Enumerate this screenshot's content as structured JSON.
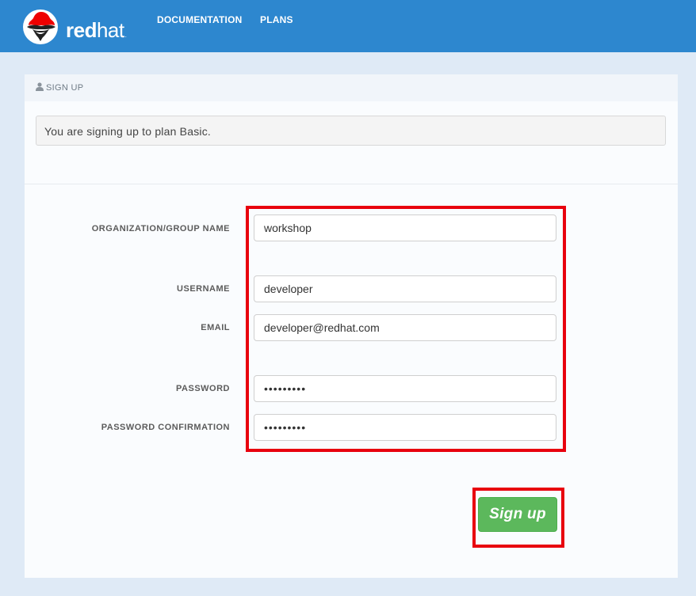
{
  "navbar": {
    "brand_bold": "red",
    "brand_light": "hat",
    "brand_dot": ".",
    "links": [
      "DOCUMENTATION",
      "PLANS"
    ]
  },
  "panel": {
    "title": "SIGN UP",
    "alert": "You are signing up to plan Basic."
  },
  "form": {
    "organization": {
      "label": "ORGANIZATION/GROUP NAME",
      "value": "workshop"
    },
    "username": {
      "label": "USERNAME",
      "value": "developer"
    },
    "email": {
      "label": "EMAIL",
      "value": "developer@redhat.com"
    },
    "password": {
      "label": "PASSWORD",
      "value": "•••••••••"
    },
    "password_confirmation": {
      "label": "PASSWORD CONFIRMATION",
      "value": "•••••••••"
    },
    "submit_label": "Sign up"
  },
  "colors": {
    "navbar": "#2d87cf",
    "highlight": "#e8000e",
    "button": "#5cb85c"
  },
  "icons": {
    "logo": "redhat-shadowman-logo",
    "panel_title": "user-icon"
  }
}
